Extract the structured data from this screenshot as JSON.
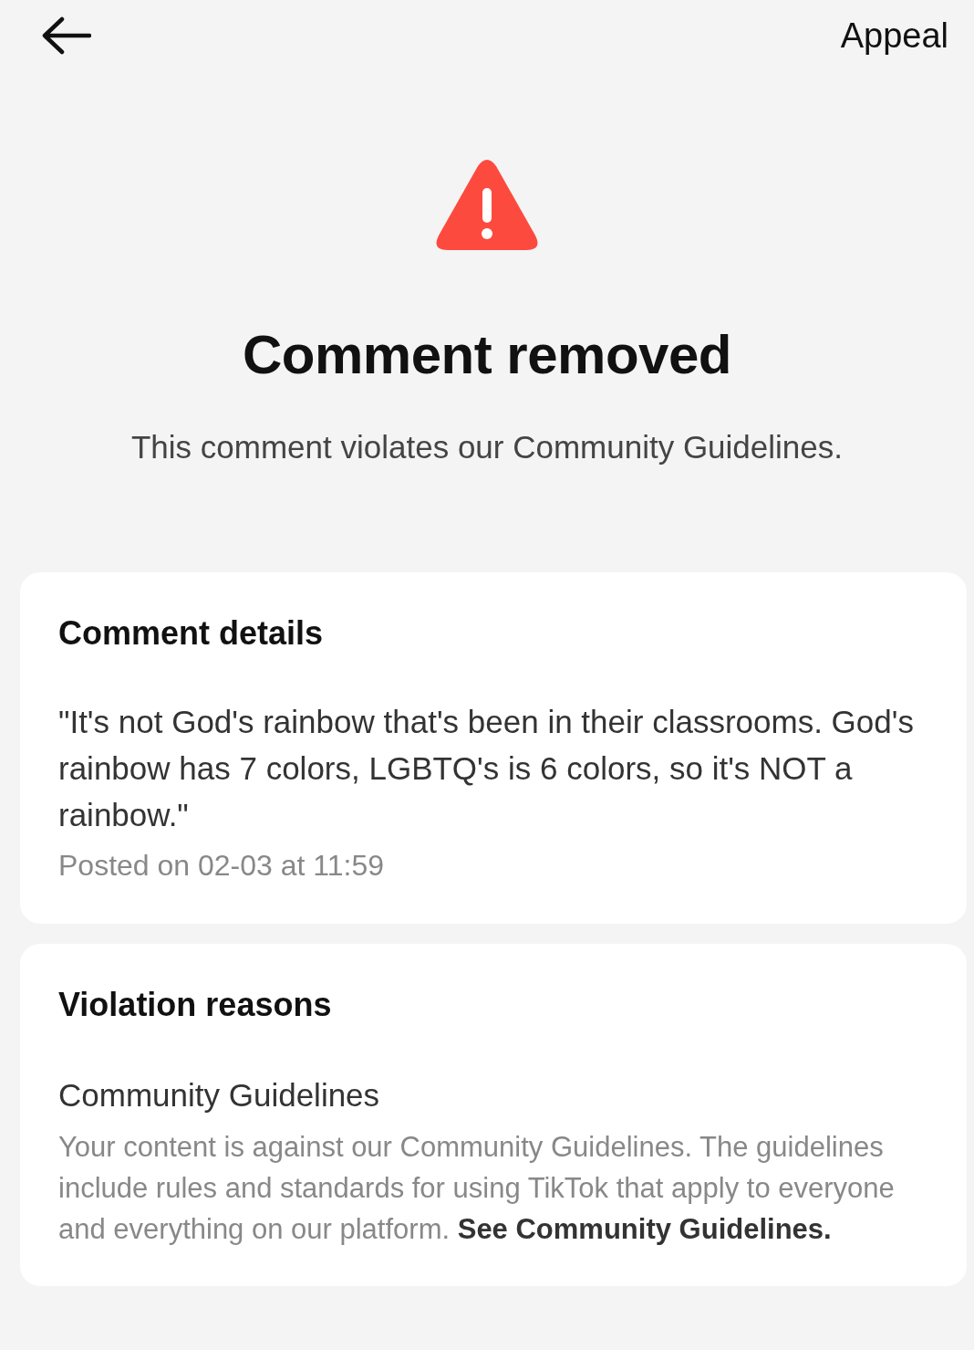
{
  "header": {
    "action": "Appeal"
  },
  "notice": {
    "title": "Comment removed",
    "subtitle": "This comment violates our Community Guidelines."
  },
  "comment_details": {
    "heading": "Comment details",
    "text": "\"It's not God's rainbow that's been in their classrooms. God's rainbow has 7 colors, LGBTQ's is 6 colors, so it's NOT a rainbow.\"",
    "posted": "Posted on 02-03 at 11:59"
  },
  "violation_reasons": {
    "heading": "Violation reasons",
    "reasons": [
      {
        "title": "Community Guidelines",
        "description": "Your content is against our Community Guidelines. The guidelines include rules and standards for using TikTok that apply to everyone and everything on our platform.",
        "link": "See Community Guidelines."
      }
    ]
  }
}
